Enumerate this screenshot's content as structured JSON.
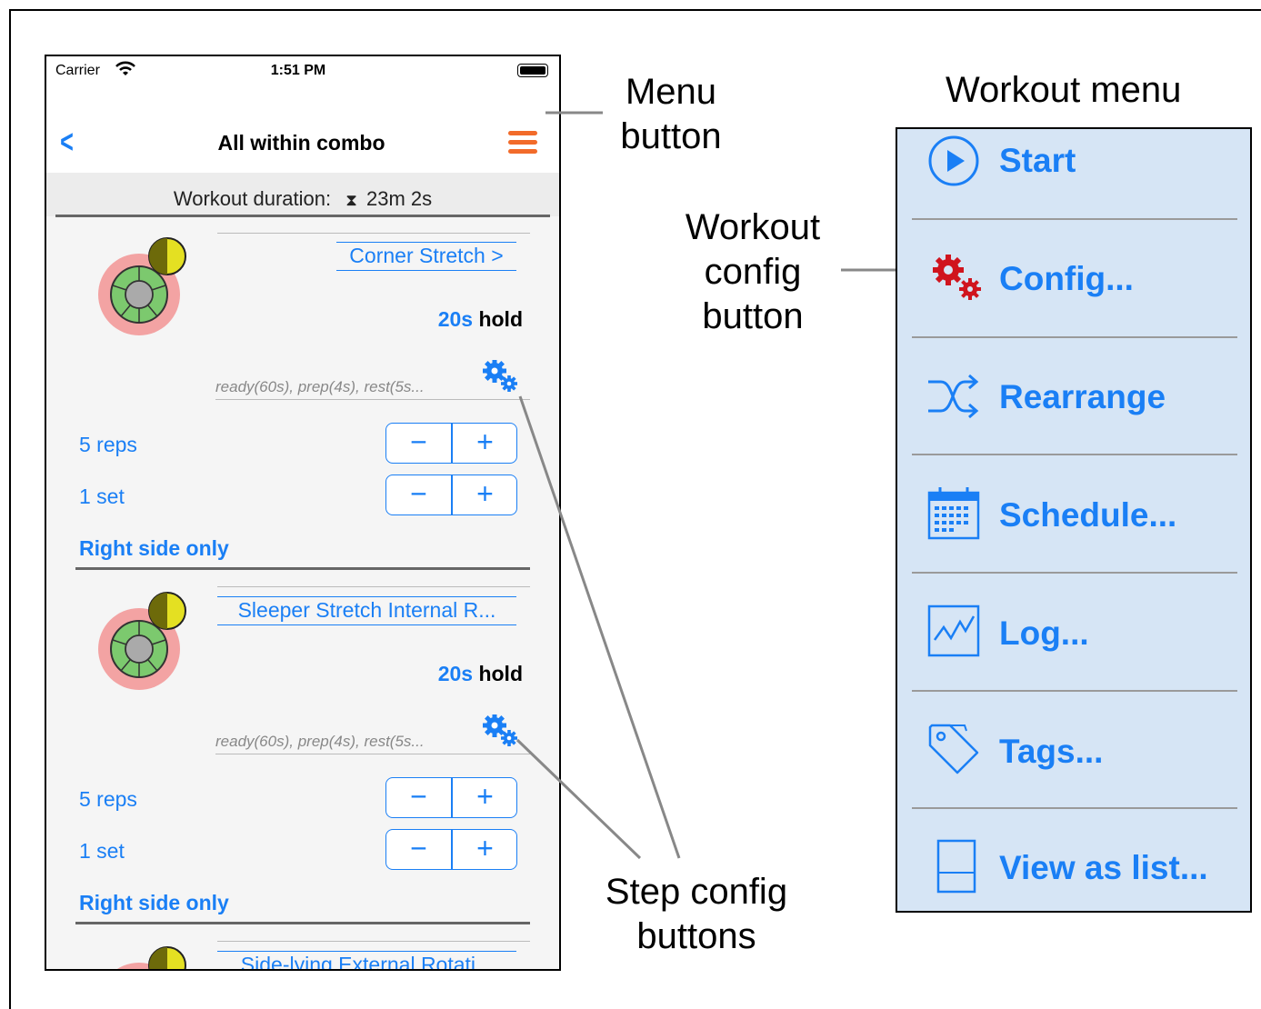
{
  "phone": {
    "status": {
      "carrier": "Carrier",
      "time": "1:51 PM"
    },
    "nav": {
      "back_icon": "chevron-left-icon",
      "title": "All within combo",
      "menu_icon": "hamburger-icon"
    },
    "duration": {
      "label": "Workout duration:",
      "icon": "hourglass-icon",
      "value": "23m 2s"
    },
    "steps": [
      {
        "name": "Corner Stretch >",
        "hold_value": "20s",
        "hold_unit": "hold",
        "timing": "ready(60s), prep(4s), rest(5s...",
        "reps_label": "5 reps",
        "sets_label": "1 set",
        "side": "Right side only"
      },
      {
        "name": "Sleeper Stretch Internal R...",
        "hold_value": "20s",
        "hold_unit": "hold",
        "timing": "ready(60s), prep(4s), rest(5s...",
        "reps_label": "5 reps",
        "sets_label": "1 set",
        "side": "Right side only"
      },
      {
        "name": "Side-lying External Rotati..."
      }
    ],
    "stepper": {
      "minus": "−",
      "plus": "+"
    },
    "colors": {
      "accent": "#1a7ff5",
      "menu": "#f26b2a"
    }
  },
  "callouts": {
    "menu_button": [
      "Menu",
      "button"
    ],
    "workout_config": [
      "Workout",
      "config",
      "button"
    ],
    "step_config": [
      "Step config",
      "buttons"
    ]
  },
  "workout_menu": {
    "title": "Workout menu",
    "items": [
      {
        "label": "Start",
        "icon": "play-circle-icon"
      },
      {
        "label": "Config...",
        "icon": "red-gears-icon"
      },
      {
        "label": "Rearrange",
        "icon": "shuffle-icon"
      },
      {
        "label": "Schedule...",
        "icon": "calendar-icon"
      },
      {
        "label": "Log...",
        "icon": "chart-icon"
      },
      {
        "label": "Tags...",
        "icon": "tag-icon"
      },
      {
        "label": "View as list...",
        "icon": "list-view-icon"
      }
    ],
    "colors": {
      "background": "#d6e5f5",
      "accent": "#1a7ff5"
    }
  }
}
